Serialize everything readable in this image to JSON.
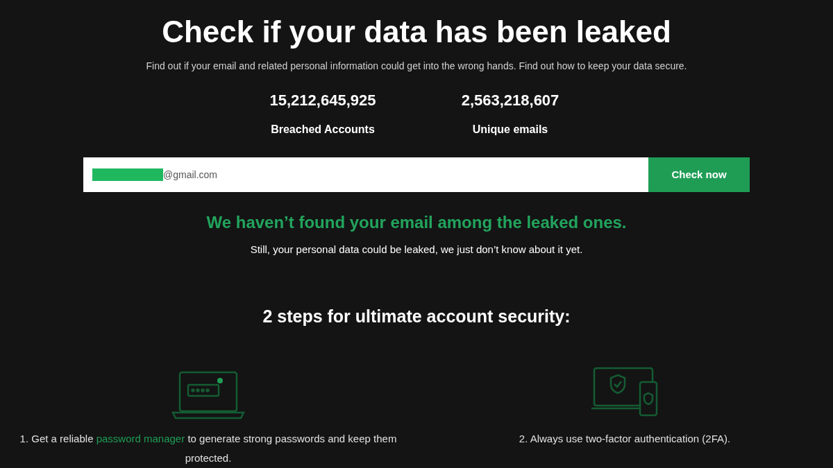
{
  "title": "Check if your data has been leaked",
  "subtitle": "Find out if your email and related personal information could get into the wrong hands. Find out how to keep your data secure.",
  "stats": [
    {
      "value": "15,212,645,925",
      "label": "Breached Accounts"
    },
    {
      "value": "2,563,218,607",
      "label": "Unique emails"
    }
  ],
  "search": {
    "value": "@gmail.com",
    "redacted": true,
    "button": "Check now"
  },
  "result": {
    "headline": "We haven’t found your email among the leaked ones.",
    "note": "Still, your personal data could be leaked, we just don’t know about it yet."
  },
  "steps_heading": "2 steps for ultimate account security:",
  "steps": [
    {
      "kind": "password",
      "before": "1. Get a reliable ",
      "link": "password manager",
      "after": " to generate strong passwords and keep them protected."
    },
    {
      "kind": "twofactor",
      "before": "2. Always use two-factor authentication (2FA)."
    }
  ]
}
